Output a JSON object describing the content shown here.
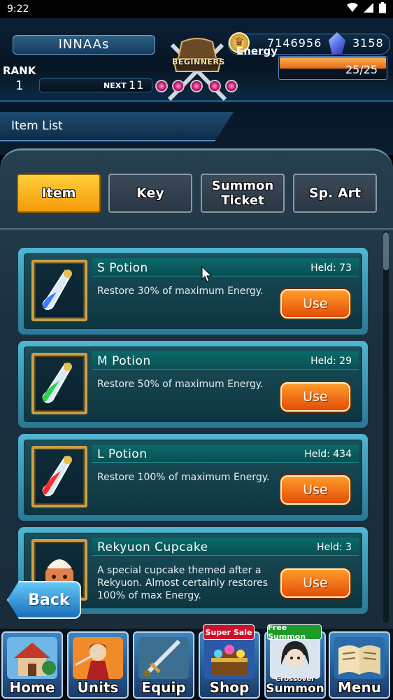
{
  "status_bar": {
    "time": "9:22"
  },
  "header": {
    "player_name": "INNAAs",
    "gold": "7146956",
    "gems": "3158",
    "rank_label": "RANK",
    "rank": "1",
    "next_label": "NEXT",
    "next_value": "11",
    "emblem_text": "BEGINNERS",
    "energy_label": "Energy",
    "energy_text": "25/25",
    "energy_fraction": 1.0
  },
  "page": {
    "title": "Item List"
  },
  "tabs": [
    {
      "label": "Item",
      "active": true
    },
    {
      "label": "Key",
      "active": false
    },
    {
      "label": "Summon Ticket",
      "active": false
    },
    {
      "label": "Sp. Art",
      "active": false
    }
  ],
  "items": [
    {
      "name": "S Potion",
      "held": "Held: 73",
      "description": "Restore 30% of maximum Energy.",
      "use_label": "Use",
      "icon": "blue-potion-icon",
      "color": "#3b7bff"
    },
    {
      "name": "M Potion",
      "held": "Held: 29",
      "description": "Restore 50% of maximum Energy.",
      "use_label": "Use",
      "icon": "green-potion-icon",
      "color": "#2ed24a"
    },
    {
      "name": "L Potion",
      "held": "Held: 434",
      "description": "Restore 100% of maximum Energy.",
      "use_label": "Use",
      "icon": "red-potion-icon",
      "color": "#ff2b2b"
    },
    {
      "name": "Rekyuon Cupcake",
      "held": "Held: 3",
      "description": "A special cupcake themed after a Rekyuon. Almost certainly restores 100% of max Energy.",
      "use_label": "Use",
      "icon": "cupcake-icon",
      "color": "#e0804a"
    }
  ],
  "back_label": "Back",
  "nav": {
    "home": "Home",
    "units": "Units",
    "equip": "Equip",
    "shop": "Shop",
    "shop_badge": "Super Sale",
    "summon": "Summon",
    "summon_badge": "Free Summon",
    "summon_sub": "Crossover",
    "menu": "Menu"
  }
}
